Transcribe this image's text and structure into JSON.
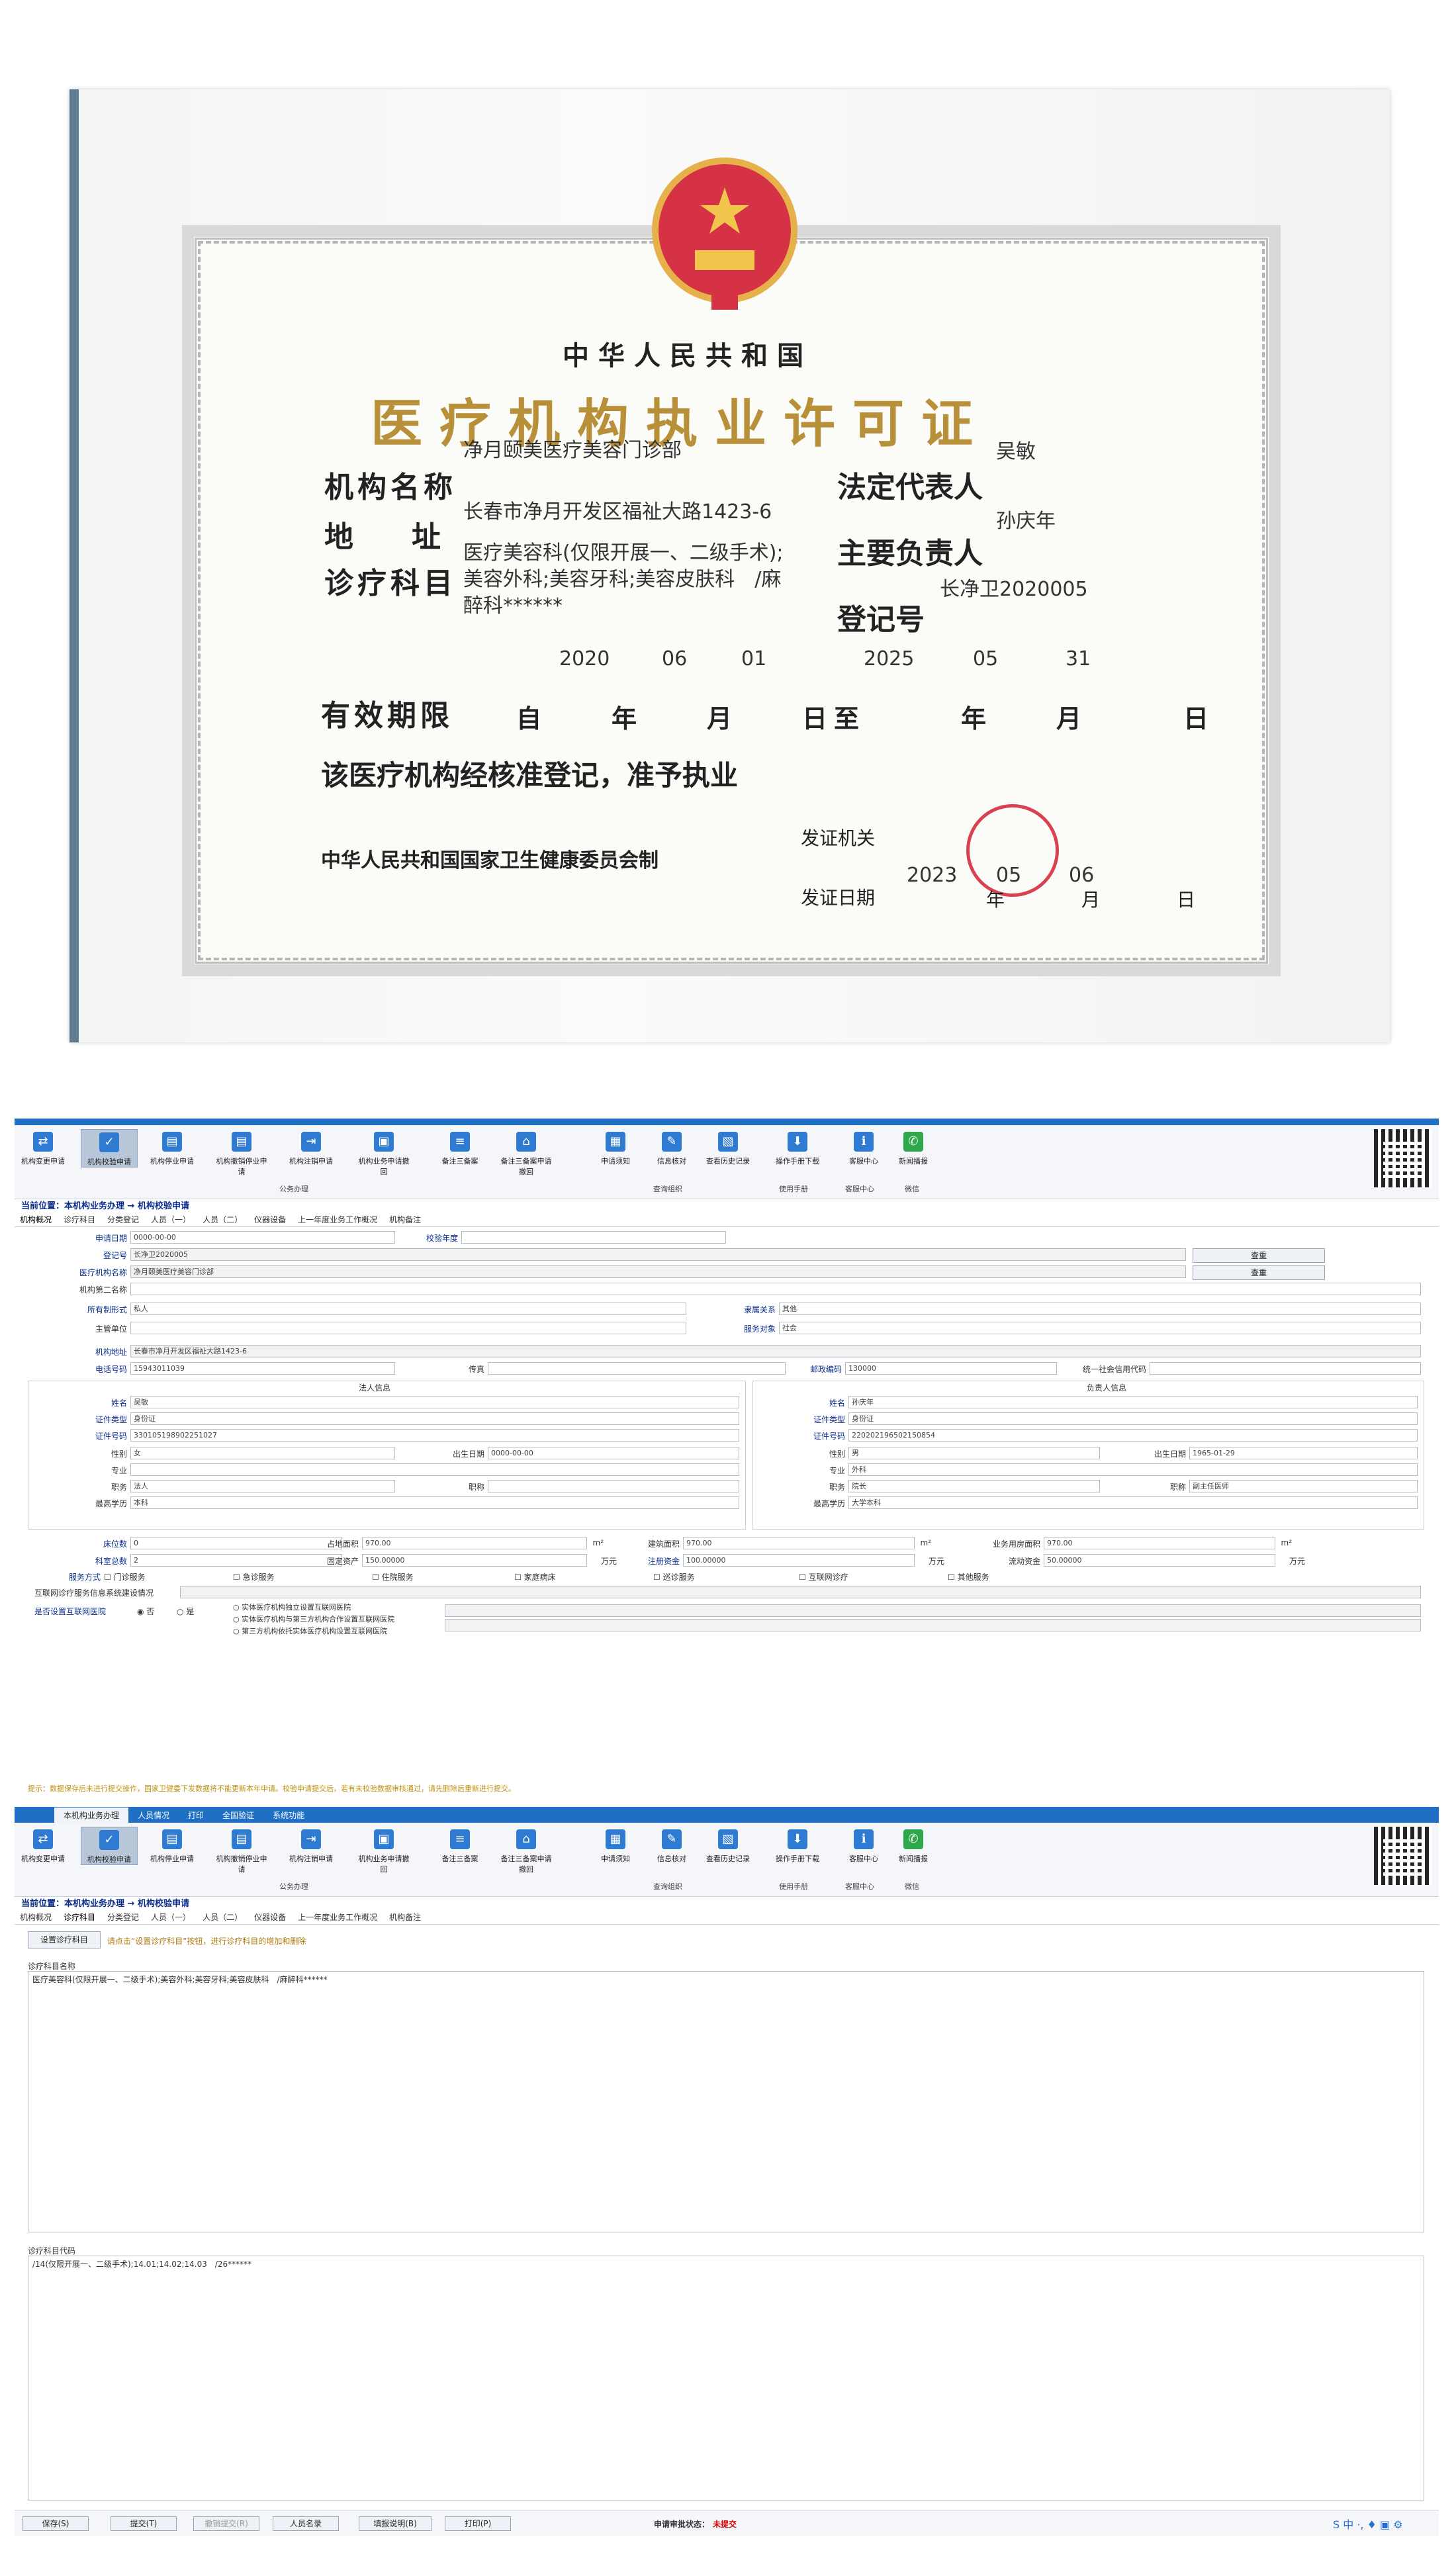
{
  "certificate": {
    "country": "中华人民共和国",
    "title": "医疗机构执业许可证",
    "org_label": "机构名称",
    "org_value": "净月颐美医疗美容门诊部",
    "addr_label": "地　　址",
    "addr_value": "长春市净月开发区福祉大路1423-6",
    "dept_label": "诊疗科目",
    "dept_value1": "医疗美容科(仅限开展一、二级手术);",
    "dept_value2": "美容外科;美容牙科;美容皮肤科　/麻",
    "dept_value3": "醉科******",
    "legal_label": "法定代表人",
    "legal_value": "吴敏",
    "head_label": "主要负责人",
    "head_value": "孙庆年",
    "reg_label": "登记号",
    "reg_value": "长净卫2020005",
    "valid_label": "有效期限",
    "valid_from_y": "2020",
    "valid_from_m": "06",
    "valid_from_d": "01",
    "valid_to_y": "2025",
    "valid_to_m": "05",
    "valid_to_d": "31",
    "valid_row": "自　　年　　月　　日至　　　年　　月　　　日",
    "approval": "该医疗机构经核准登记，准予执业",
    "issuer_label": "发证机关",
    "maker": "中华人民共和国国家卫生健康委员会制",
    "issue_date_label": "发证日期",
    "issue_date_row": "年　　月　　日",
    "issue_y": "2023",
    "issue_m": "05",
    "issue_d": "06"
  },
  "ribbon": {
    "buttons": [
      "机构变更申请",
      "机构校验申请",
      "机构停业申请",
      "机构撤销停业申请",
      "机构注销申请",
      "机构业务申请撤回",
      "备注三备案",
      "备注三备案申请撤回",
      "申请须知",
      "信息核对",
      "查看历史记录",
      "操作手册下载",
      "客服中心",
      "新闻播报"
    ],
    "groups": [
      "公务办理",
      "查询组织",
      "使用手册",
      "客服中心",
      "微信"
    ]
  },
  "page1": {
    "position": "当前位置：本机构业务办理 → 机构校验申请",
    "tabs": [
      "机构概况",
      "诊疗科目",
      "分类登记",
      "人员（一）",
      "人员（二）",
      "仪器设备",
      "上一年度业务工作概况",
      "机构备注"
    ],
    "fields": {
      "apply_date_l": "申请日期",
      "apply_date_v": "0000-00-00",
      "verify_year_l": "校验年度",
      "reg_no_l": "登记号",
      "reg_no_v": "长净卫2020005",
      "org_name_l": "医疗机构名称",
      "org_name_v": "净月颐美医疗美容门诊部",
      "second_name_l": "机构第二名称",
      "query": "查重",
      "own_l": "所有制形式",
      "own_v": "私人",
      "affil_l": "隶属关系",
      "affil_v": "其他",
      "super_l": "主管单位",
      "service_l": "服务对象",
      "service_v": "社会",
      "addr_l": "机构地址",
      "addr_v": "长春市净月开发区福祉大路1423-6",
      "phone_l": "电话号码",
      "phone_v": "15943011039",
      "fax_l": "传真",
      "zip_l": "邮政编码",
      "zip_v": "130000",
      "credit_l": "统一社会信用代码",
      "legal_hd": "法人信息",
      "head_hd": "负责人信息",
      "name_l": "姓名",
      "legal_name": "吴敏",
      "head_name": "孙庆年",
      "idtype_l": "证件类型",
      "idtype_v": "身份证",
      "idno_l": "证件号码",
      "legal_id": "330105198902251027",
      "head_id": "220202196502150854",
      "sex_l": "性别",
      "legal_sex": "女",
      "head_sex": "男",
      "birth_l": "出生日期",
      "legal_birth": "0000-00-00",
      "head_birth": "1965-01-29",
      "major_l": "专业",
      "head_major": "外科",
      "job_l": "职务",
      "legal_job": "法人",
      "head_job": "院长",
      "title_l": "职称",
      "head_title": "副主任医师",
      "edu_l": "最高学历",
      "legal_edu": "本科",
      "head_edu": "大学本科",
      "beds_l": "床位数",
      "beds_v": "0",
      "area_l": "占地面积",
      "area_v": "970.00",
      "build_l": "建筑面积",
      "build_v": "970.00",
      "house_l": "业务用房面积",
      "house_v": "970.00",
      "m2": "m²",
      "wan": "万元",
      "depts_l": "科室总数",
      "depts_v": "2",
      "fixed_l": "固定资产",
      "fixed_v": "150.00000",
      "reg_cap_l": "注册资金",
      "reg_cap_v": "100.00000",
      "flow_l": "流动资金",
      "flow_v": "50.00000",
      "svc_l": "服务方式",
      "svc": [
        "门诊服务",
        "急诊服务",
        "住院服务",
        "家庭病床",
        "巡诊服务",
        "互联网诊疗",
        "其他服务"
      ],
      "net_name_l": "互联网诊疗服务信息系统建设情况",
      "net_l": "是否设置互联网医院",
      "net_yes": "是",
      "net_no": "否",
      "net_opts": [
        "实体医疗机构独立设置互联网医院",
        "实体医疗机构与第三方机构合作设置互联网医院",
        "第三方机构依托实体医疗机构设置互联网医院"
      ]
    },
    "warning": "提示：数据保存后未进行提交操作，国家卫健委下发数据将不能更新本年申请。校验申请提交后，若有未校验数据审核通过，请先删除后重新进行提交。"
  },
  "page2": {
    "tabs_top": [
      "本机构业务办理",
      "人员情况",
      "打印",
      "全国验证",
      "系统功能"
    ],
    "position": "当前位置：本机构业务办理 → 机构校验申请",
    "tabs": [
      "机构概况",
      "诊疗科目",
      "分类登记",
      "人员（一）",
      "人员（二）",
      "仪器设备",
      "上一年度业务工作概况",
      "机构备注"
    ],
    "set_btn": "设置诊疗科目",
    "hint": "请点击“设置诊疗科目”按钮，进行诊疗科目的增加和删除",
    "names_l": "诊疗科目名称",
    "names_v": "医疗美容科(仅限开展一、二级手术);美容外科;美容牙科;美容皮肤科　/麻醉科******",
    "codes_l": "诊疗科目代码",
    "codes_v": "/14(仅限开展一、二级手术);14.01;14.02;14.03　/26******"
  },
  "footer": {
    "buttons": [
      "保存(S)",
      "提交(T)",
      "撤销提交(R)",
      "人员名录",
      "填报说明(B)",
      "打印(P)"
    ],
    "status_l": "申请审批状态：",
    "status_v": "未提交"
  }
}
